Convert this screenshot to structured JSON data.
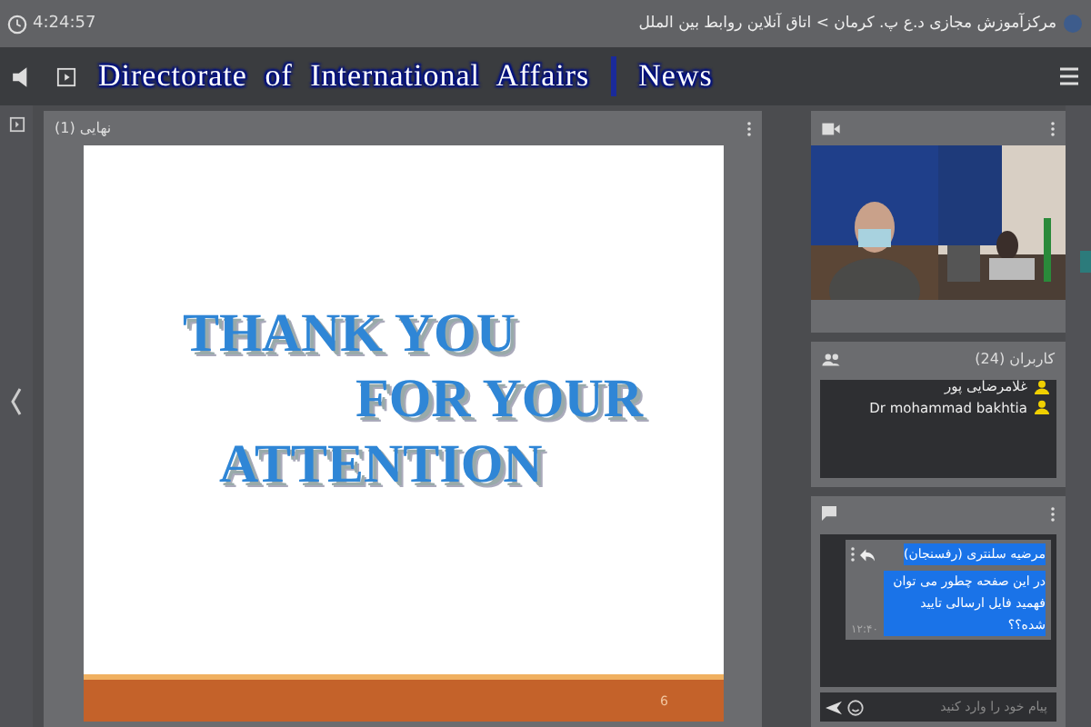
{
  "top_bar": {
    "clock": "4:24:57",
    "breadcrumb": "مرکزآموزش مجازی د.ع پ. کرمان > اتاق آنلاین روابط بین الملل"
  },
  "banner": {
    "title": "Directorate of International Affairs",
    "section": "News"
  },
  "share_pod": {
    "title": "نهایی (1)",
    "slide": {
      "lines": [
        "THANK YOU",
        "FOR YOUR",
        "ATTENTION"
      ],
      "page": "6"
    }
  },
  "attendees_pod": {
    "title": "کاربران (24)",
    "attendees": [
      {
        "name": "غلامرضایی پور"
      },
      {
        "name": "Dr mohammad bakhtia"
      }
    ]
  },
  "chat_pod": {
    "messages": [
      {
        "sender": "مرضیه سلنتری (رفسنجان)",
        "text": "در این صفحه چطور می توان فهمید فایل ارسالی تایید شده؟؟",
        "time": "۱۲:۴۰"
      }
    ],
    "input": {
      "placeholder": "پیام خود را وارد کنید"
    }
  }
}
